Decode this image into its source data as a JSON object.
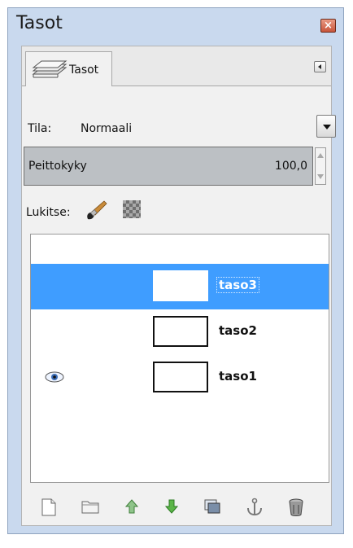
{
  "window": {
    "title": "Tasot"
  },
  "tab": {
    "label": "Tasot"
  },
  "mode": {
    "label": "Tila:",
    "value": "Normaali"
  },
  "opacity": {
    "label": "Peittokyky",
    "value": "100,0"
  },
  "lock": {
    "label": "Lukitse:"
  },
  "layers": [
    {
      "name": "taso3",
      "selected": true,
      "visible": false
    },
    {
      "name": "taso2",
      "selected": false,
      "visible": false
    },
    {
      "name": "taso1",
      "selected": false,
      "visible": true
    }
  ],
  "toolbar": {
    "icons": [
      "new-layer-icon",
      "new-layer-group-icon",
      "raise-layer-icon",
      "lower-layer-icon",
      "duplicate-layer-icon",
      "anchor-layer-icon",
      "delete-layer-icon"
    ]
  },
  "colors": {
    "selection": "#3f9dff",
    "frame": "#c9d9ee",
    "close": "#c8553b"
  }
}
